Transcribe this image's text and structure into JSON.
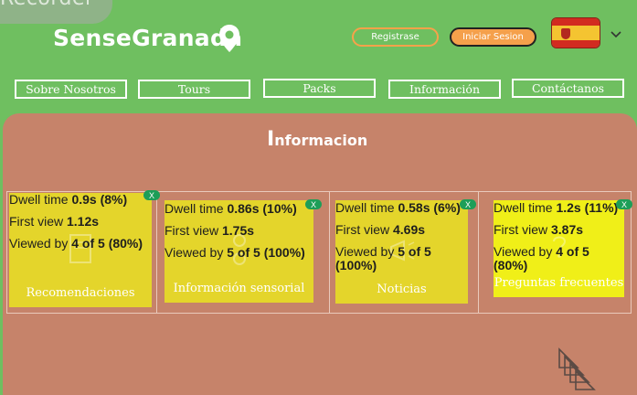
{
  "recorder": {
    "label": "Recorder"
  },
  "header": {
    "logo": "SenseGranada",
    "register_label": "Registrase",
    "login_label": "Iniciar Sesion",
    "language_flag": "spain-flag"
  },
  "nav": {
    "items": [
      {
        "label": "Sobre Nosotros"
      },
      {
        "label": "Tours"
      },
      {
        "label": "Packs"
      },
      {
        "label": "Información"
      },
      {
        "label": "Contáctanos"
      }
    ]
  },
  "main": {
    "title_initial": "I",
    "title_rest": "nformacion",
    "cards": [
      {
        "label": "Recomendaciones",
        "icon": "document-icon",
        "dwell_prefix": "Dwell time ",
        "dwell": "0.9s (8%)",
        "first_prefix": "First view ",
        "first": "1.12s",
        "viewed_prefix": "Viewed by ",
        "viewed": "4 of 5 (80%)",
        "badge": "X"
      },
      {
        "label": "Información sensorial",
        "icon": "senses-icon",
        "dwell_prefix": "Dwell time ",
        "dwell": "0.86s (10%)",
        "first_prefix": "First view ",
        "first": "1.75s",
        "viewed_prefix": "Viewed by ",
        "viewed": "5 of 5 (100%)",
        "badge": "X"
      },
      {
        "label": "Noticias",
        "icon": "megaphone-icon",
        "dwell_prefix": "Dwell time ",
        "dwell": "0.58s (6%)",
        "first_prefix": "First view ",
        "first": "4.69s",
        "viewed_prefix": "Viewed by ",
        "viewed_line1": "5 of 5",
        "viewed_line2": "(100%)",
        "badge": "X"
      },
      {
        "label": "Preguntas frecuentes",
        "icon": "question-icon",
        "dwell_prefix": "Dwell time ",
        "dwell": "1.2s (11%)",
        "first_prefix": "First view ",
        "first": "3.87s",
        "viewed_prefix": "Viewed by ",
        "viewed_line1": "4 of 5",
        "viewed_line2": "(80%)",
        "badge": "X"
      }
    ]
  },
  "colors": {
    "header_bg": "#6fbf60",
    "panel_bg": "#c6836a",
    "card": "#e4d52b",
    "accent": "#f5a04b",
    "badge": "#1d9e58"
  }
}
